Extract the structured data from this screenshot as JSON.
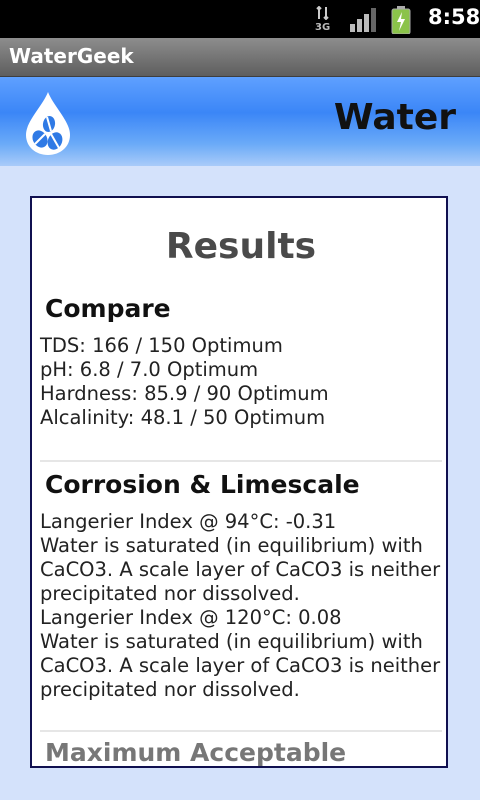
{
  "status_bar": {
    "network": "3G",
    "time": "8:58"
  },
  "app": {
    "title": "WaterGeek"
  },
  "header": {
    "title": "Water",
    "logo_icon": "water-drop-beans-icon"
  },
  "results": {
    "title": "Results",
    "sections": [
      {
        "heading": "Compare",
        "lines": [
          "TDS: 166 / 150 Optimum",
          "pH: 6.8 / 7.0 Optimum",
          "Hardness: 85.9 / 90 Optimum",
          "Alcalinity: 48.1 / 50 Optimum"
        ]
      },
      {
        "heading": "Corrosion & Limescale",
        "lines": [
          "Langerier Index @ 94°C: -0.31",
          "Water is saturated (in equilibrium) with",
          "CaCO3. A scale layer of CaCO3 is neither",
          "precipitated nor dissolved.",
          "Langerier Index @ 120°C: 0.08",
          "Water is saturated (in equilibrium) with",
          "CaCO3. A scale layer of CaCO3 is neither",
          "precipitated nor dissolved."
        ]
      },
      {
        "heading": "Maximum Acceptable"
      }
    ]
  },
  "colors": {
    "header_blue": "#3b86f7",
    "page_background": "#d4e2fb",
    "card_border": "#101050"
  }
}
